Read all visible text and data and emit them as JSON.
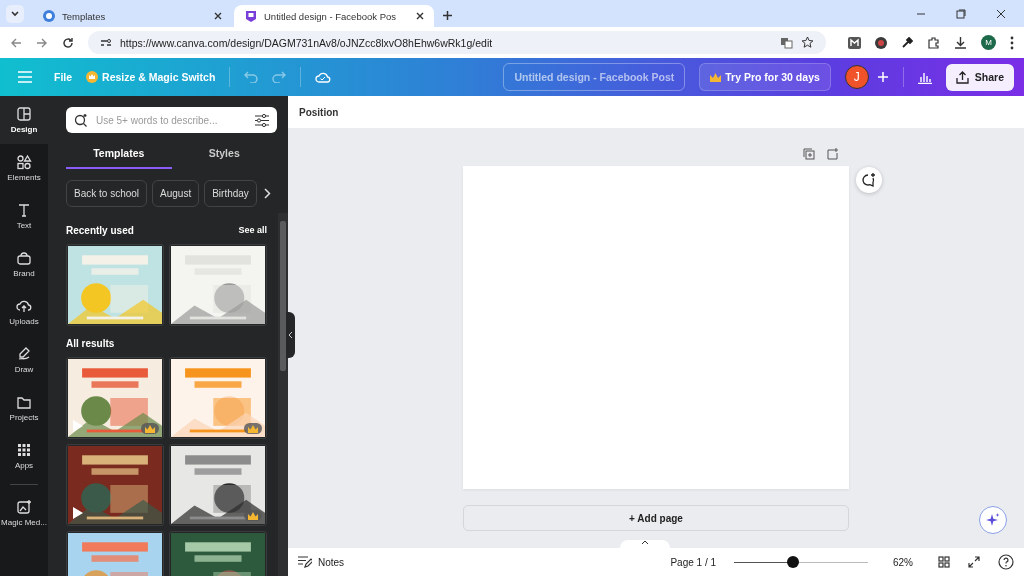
{
  "browser": {
    "tabs": [
      {
        "title": "Templates",
        "selected": false
      },
      {
        "title": "Untitled design - Facebook Pos",
        "selected": true
      }
    ],
    "url": "https://www.canva.com/design/DAGM731nAv8/oJNZcc8lxvO8hEhw6wRk1g/edit",
    "profile_initial": "M"
  },
  "toolbar": {
    "file": "File",
    "resize": "Resize & Magic Switch",
    "document_title": "Untitled design - Facebook Post",
    "pro_button": "Try Pro for 30 days",
    "avatar_initial": "J",
    "share": "Share"
  },
  "rail": [
    {
      "label": "Design",
      "selected": true
    },
    {
      "label": "Elements",
      "selected": false
    },
    {
      "label": "Text",
      "selected": false
    },
    {
      "label": "Brand",
      "selected": false
    },
    {
      "label": "Uploads",
      "selected": false
    },
    {
      "label": "Draw",
      "selected": false
    },
    {
      "label": "Projects",
      "selected": false
    },
    {
      "label": "Apps",
      "selected": false
    },
    {
      "label": "Magic Med...",
      "selected": false
    }
  ],
  "panel": {
    "search_placeholder": "Use 5+ words to describe...",
    "tabs": [
      {
        "label": "Templates",
        "selected": true
      },
      {
        "label": "Styles",
        "selected": false
      }
    ],
    "chips": [
      "Back to school",
      "August",
      "Birthday"
    ],
    "recent_heading": "Recently used",
    "see_all": "See all",
    "recent": [
      {
        "kind": "picture",
        "video": false,
        "pro": false
      },
      {
        "kind": "picture",
        "video": false,
        "pro": false
      }
    ],
    "results_heading": "All results",
    "results": [
      {
        "kind": "picture",
        "video": true,
        "pro": true
      },
      {
        "kind": "picture",
        "video": false,
        "pro": true
      },
      {
        "kind": "picture",
        "video": true,
        "pro": false
      },
      {
        "kind": "picture",
        "video": false,
        "pro": true
      },
      {
        "kind": "picture"
      },
      {
        "kind": "picture"
      }
    ]
  },
  "editor": {
    "context": "Position",
    "add_page": "+ Add page",
    "notes": "Notes",
    "page_indicator": "Page 1 / 1",
    "zoom": {
      "level": 0.44,
      "reading": "62%"
    }
  }
}
